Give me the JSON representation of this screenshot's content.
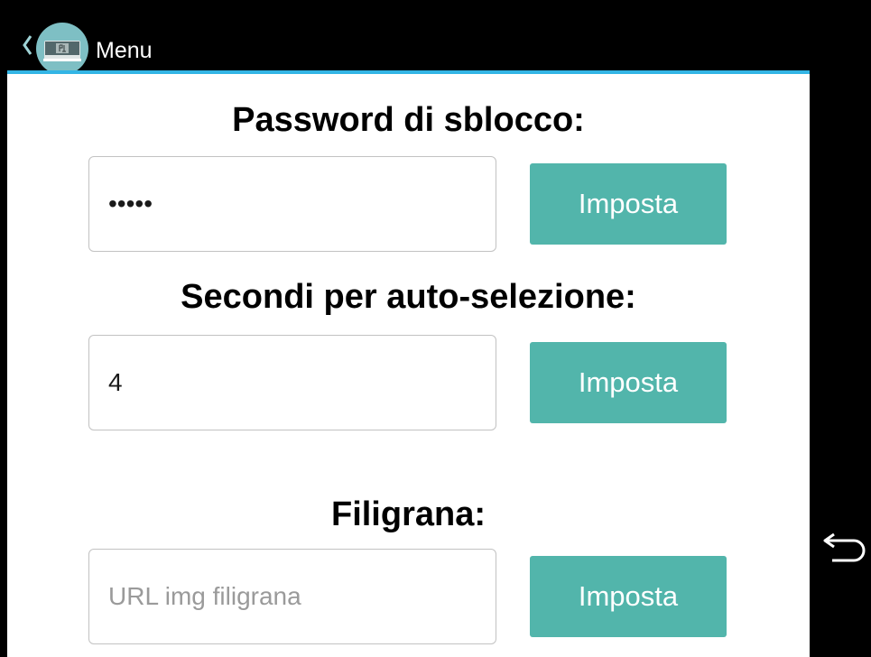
{
  "actionbar": {
    "title": "Menu"
  },
  "icons": {
    "up": "chevron-left-icon",
    "app": "app-logo-icon",
    "back": "back-icon"
  },
  "colors": {
    "accent_line": "#33b5e5",
    "button": "#52b5ab",
    "app_icon_bg": "#7ebfc4"
  },
  "sections": [
    {
      "title": "Password di sblocco:",
      "value": "•••••",
      "placeholder": "",
      "button_label": "Imposta"
    },
    {
      "title": "Secondi per auto-selezione:",
      "value": "4",
      "placeholder": "",
      "button_label": "Imposta"
    },
    {
      "title": "Filigrana:",
      "value": "",
      "placeholder": "URL img filigrana",
      "button_label": "Imposta"
    }
  ]
}
